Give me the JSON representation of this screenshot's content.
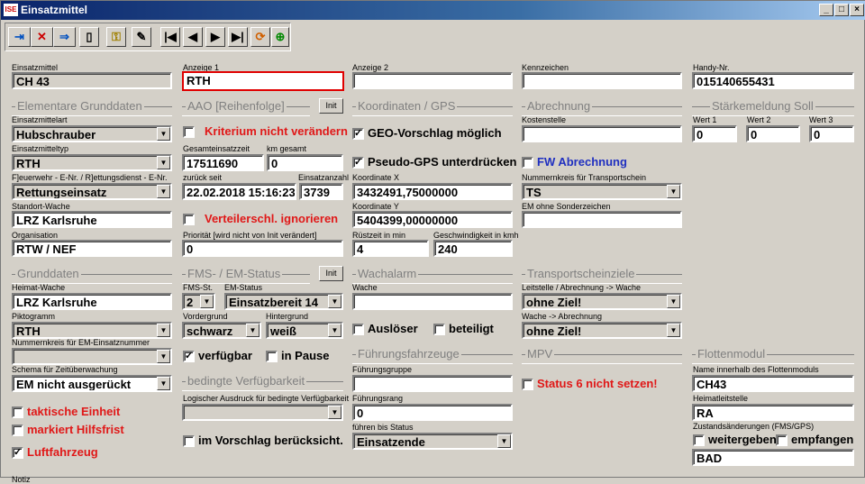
{
  "window": {
    "title": "Einsatzmittel",
    "app_icon": "ISE"
  },
  "toolbar": {
    "buttons": [
      "save-icon",
      "delete-icon",
      "transfer-icon",
      "new-doc-icon",
      "key-icon",
      "edit-icon",
      "first-icon",
      "prev-icon",
      "next-icon",
      "last-icon",
      "refresh-icon",
      "map-icon"
    ]
  },
  "f": {
    "einsatzmittel_l": "Einsatzmittel",
    "einsatzmittel": "CH 43",
    "anzeige1_l": "Anzeige 1",
    "anzeige1": "RTH",
    "anzeige2_l": "Anzeige 2",
    "anzeige2": "",
    "kennzeichen_l": "Kennzeichen",
    "kennzeichen": "",
    "handy_l": "Handy-Nr.",
    "handy": "015140655431",
    "g_elem": "Elementare Grunddaten",
    "art_l": "Einsatzmittelart",
    "art": "Hubschrauber",
    "typ_l": "Einsatzmitteltyp",
    "typ": "RTH",
    "fr_l": "F]euerwehr - E-Nr. / R]ettungsdienst - E-Nr.",
    "fr": "Rettungseinsatz",
    "standort_l": "Standort-Wache",
    "standort": "LRZ Karlsruhe",
    "org_l": "Organisation",
    "org": "RTW / NEF",
    "g_aao": "AAO [Reihenfolge]",
    "init": "Init",
    "krit": "Kriterium nicht verändern",
    "gesamtzeit_l": "Gesamteinsatzzeit",
    "gesamtzeit": "17511690",
    "kmges_l": "km gesamt",
    "kmges": "0",
    "zurueck_l": "zurück seit",
    "zurueck": "22.02.2018 15:16:23",
    "anzahl_l": "Einsatzanzahl",
    "anzahl": "3739",
    "verteiler": "Verteilerschl. ignorieren",
    "prio_l": "Priorität [wird nicht von Init verändert]",
    "prio": "0",
    "g_koord": "Koordinaten / GPS",
    "geo": "GEO-Vorschlag möglich",
    "pseudo": "Pseudo-GPS unterdrücken",
    "kx_l": "Koordinate X",
    "kx": "3432491,75000000",
    "ky_l": "Koordinate Y",
    "ky": "5404399,00000000",
    "ruest_l": "Rüstzeit in min",
    "ruest": "4",
    "geschw_l": "Geschwindigkeit in kmh",
    "geschw": "240",
    "g_abr": "Abrechnung",
    "kst_l": "Kostenstelle",
    "kst": "",
    "fw_abr": "FW Abrechnung",
    "nrkreis_l": "Nummernkreis für Transportschein",
    "nrkreis": "TS",
    "ohne_l": "EM ohne Sonderzeichen",
    "ohne": "",
    "g_staerke": "Stärkemeldung Soll",
    "w1_l": "Wert 1",
    "w1": "0",
    "w2_l": "Wert 2",
    "w2": "0",
    "w3_l": "Wert 3",
    "w3": "0",
    "g_grund": "Grunddaten",
    "heimat_l": "Heimat-Wache",
    "heimat": "LRZ Karlsruhe",
    "pikto_l": "Piktogramm",
    "pikto": "RTH",
    "nrkreisem_l": "Nummernkreis für EM-Einsatznummer",
    "nrkreisem": "",
    "schema_l": "Schema für Zeitüberwachung",
    "schema": "EM nicht ausgerückt",
    "taktisch": "taktische Einheit",
    "hilfsfrist": "markiert Hilfsfrist",
    "luftfahrzeug": "Luftfahrzeug",
    "g_fms": "FMS- / EM-Status",
    "fmsst_l": "FMS-St.",
    "fmsst": "2",
    "emstatus_l": "EM-Status",
    "emstatus": "Einsatzbereit 14",
    "vg_l": "Vordergrund",
    "vg": "schwarz",
    "hg_l": "Hintergrund",
    "hg": "weiß",
    "verfuegbar": "verfügbar",
    "inpause": "in Pause",
    "g_bed": "bedingte Verfügbarkeit",
    "logik_l": "Logischer Ausdruck für bedingte Verfügbarkeit",
    "logik": "",
    "imvorschlag": "im Vorschlag berücksicht.",
    "g_wach": "Wachalarm",
    "wache_l": "Wache",
    "wache": "",
    "ausloeser": "Auslöser",
    "beteiligt": "beteiligt",
    "g_fzg": "Führungsfahrzeuge",
    "fgruppe_l": "Führungsgruppe",
    "fgruppe": "",
    "frang_l": "Führungsrang",
    "frang": "0",
    "fbis_l": "führen bis Status",
    "fbis": "Einsatzende",
    "g_trans": "Transportscheinziele",
    "ls_l": "Leitstelle / Abrechnung -> Wache",
    "ls": "ohne Ziel!",
    "wa_l": "Wache -> Abrechnung",
    "wa": "ohne Ziel!",
    "g_mpv": "MPV",
    "status6": "Status 6 nicht setzen!",
    "g_flotte": "Flottenmodul",
    "fname_l": "Name innerhalb des Flottenmoduls",
    "fname": "CH43",
    "hst_l": "Heimatleitstelle",
    "hst": "RA",
    "zust_l": "Zustandsänderungen (FMS/GPS)",
    "weiter": "weitergeben",
    "empf": "empfangen",
    "zust": "BAD",
    "notiz_l": "Notiz"
  },
  "checks": {
    "krit": false,
    "verteiler": false,
    "geo": true,
    "pseudo": true,
    "fw_abr": false,
    "taktisch": false,
    "hilfsfrist": false,
    "luftfahrzeug": true,
    "verfuegbar": true,
    "inpause": false,
    "imvorschlag": false,
    "ausloeser": false,
    "beteiligt": false,
    "status6": false,
    "weiter": false,
    "empf": false
  }
}
